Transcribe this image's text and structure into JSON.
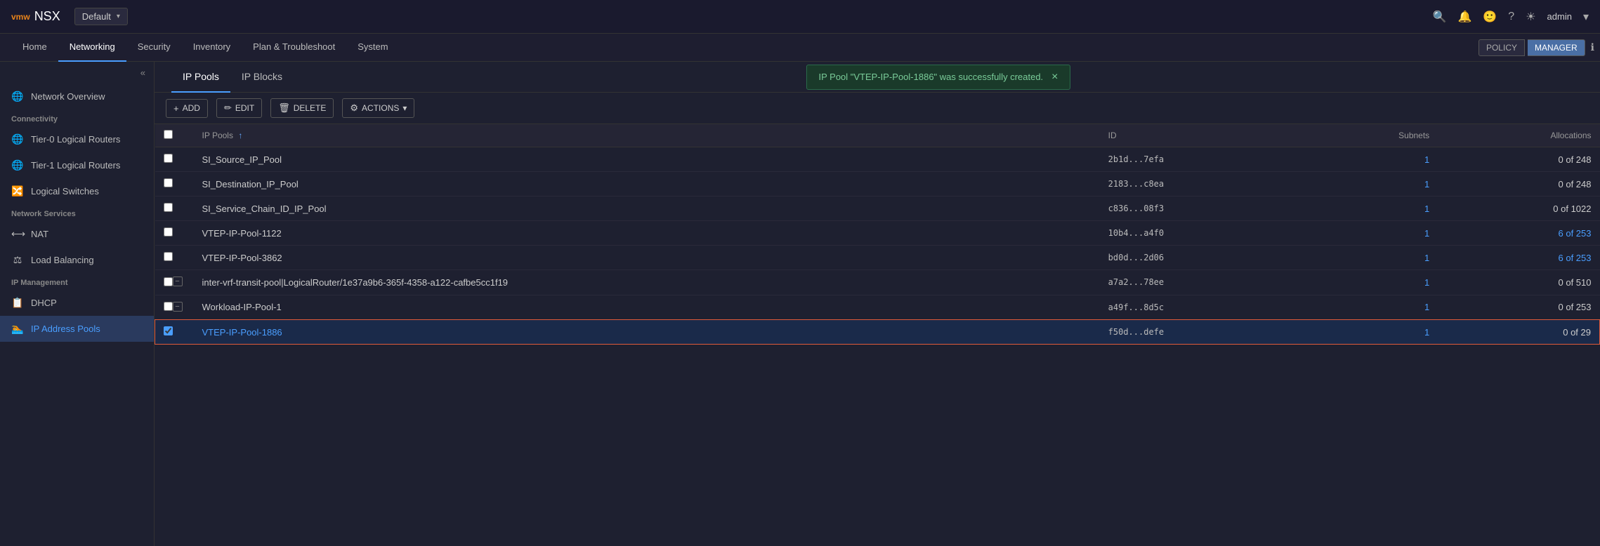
{
  "topbar": {
    "logo": "vmw",
    "app_name": "NSX",
    "env_label": "Default",
    "icons": {
      "search": "🔍",
      "bell": "🔔",
      "face": "🙂",
      "help": "?",
      "sun": "☀",
      "admin": "admin",
      "chevron": "▾"
    }
  },
  "nav": {
    "items": [
      {
        "label": "Home",
        "active": false
      },
      {
        "label": "Networking",
        "active": true
      },
      {
        "label": "Security",
        "active": false
      },
      {
        "label": "Inventory",
        "active": false
      },
      {
        "label": "Plan & Troubleshoot",
        "active": false
      },
      {
        "label": "System",
        "active": false
      }
    ],
    "policy_label": "POLICY",
    "manager_label": "MANAGER"
  },
  "sidebar": {
    "collapse_icon": "«",
    "network_overview_label": "Network Overview",
    "connectivity_label": "Connectivity",
    "connectivity_items": [
      {
        "label": "Tier-0 Logical Routers",
        "icon": "🌐"
      },
      {
        "label": "Tier-1 Logical Routers",
        "icon": "🌐"
      },
      {
        "label": "Logical Switches",
        "icon": "🔀"
      }
    ],
    "network_services_label": "Network Services",
    "network_services_items": [
      {
        "label": "NAT",
        "icon": "⟷"
      },
      {
        "label": "Load Balancing",
        "icon": "⚖"
      }
    ],
    "ip_management_label": "IP Management",
    "ip_management_items": [
      {
        "label": "DHCP",
        "icon": "📋"
      },
      {
        "label": "IP Address Pools",
        "icon": "🏊",
        "active": true
      }
    ]
  },
  "tabs": [
    {
      "label": "IP Pools",
      "active": true
    },
    {
      "label": "IP Blocks",
      "active": false
    }
  ],
  "banner": {
    "message": "IP Pool \"VTEP-IP-Pool-1886\" was successfully created.",
    "close": "×"
  },
  "toolbar": {
    "add_label": "+ ADD",
    "edit_label": "✏ EDIT",
    "delete_label": "🗑 DELETE",
    "actions_label": "⚙ ACTIONS ▾"
  },
  "table": {
    "columns": [
      {
        "label": "IP Pools",
        "sortable": true
      },
      {
        "label": "ID"
      },
      {
        "label": "Subnets",
        "align": "right"
      },
      {
        "label": "Allocations",
        "align": "right"
      }
    ],
    "rows": [
      {
        "name": "SI_Source_IP_Pool",
        "id": "2b1d...7efa",
        "subnets": "1",
        "allocations": "0 of 248",
        "selected": false,
        "has_minus": false
      },
      {
        "name": "SI_Destination_IP_Pool",
        "id": "2183...c8ea",
        "subnets": "1",
        "allocations": "0 of 248",
        "selected": false,
        "has_minus": false
      },
      {
        "name": "SI_Service_Chain_ID_IP_Pool",
        "id": "c836...08f3",
        "subnets": "1",
        "allocations": "0 of 1022",
        "selected": false,
        "has_minus": false
      },
      {
        "name": "VTEP-IP-Pool-1122",
        "id": "10b4...a4f0",
        "subnets": "1",
        "allocations": "6 of 253",
        "allocations_highlight": true,
        "selected": false,
        "has_minus": false
      },
      {
        "name": "VTEP-IP-Pool-3862",
        "id": "bd0d...2d06",
        "subnets": "1",
        "allocations": "6 of 253",
        "allocations_highlight": true,
        "selected": false,
        "has_minus": false
      },
      {
        "name": "inter-vrf-transit-pool|LogicalRouter/1e37a9b6-365f-4358-a122-cafbe5cc1f19",
        "id": "a7a2...78ee",
        "subnets": "1",
        "allocations": "0 of 510",
        "selected": false,
        "has_minus": true
      },
      {
        "name": "Workload-IP-Pool-1",
        "id": "a49f...8d5c",
        "subnets": "1",
        "allocations": "0 of 253",
        "selected": false,
        "has_minus": true
      },
      {
        "name": "VTEP-IP-Pool-1886",
        "id": "f50d...defe",
        "subnets": "1",
        "allocations": "0 of 29",
        "selected": true,
        "has_minus": false
      }
    ]
  }
}
